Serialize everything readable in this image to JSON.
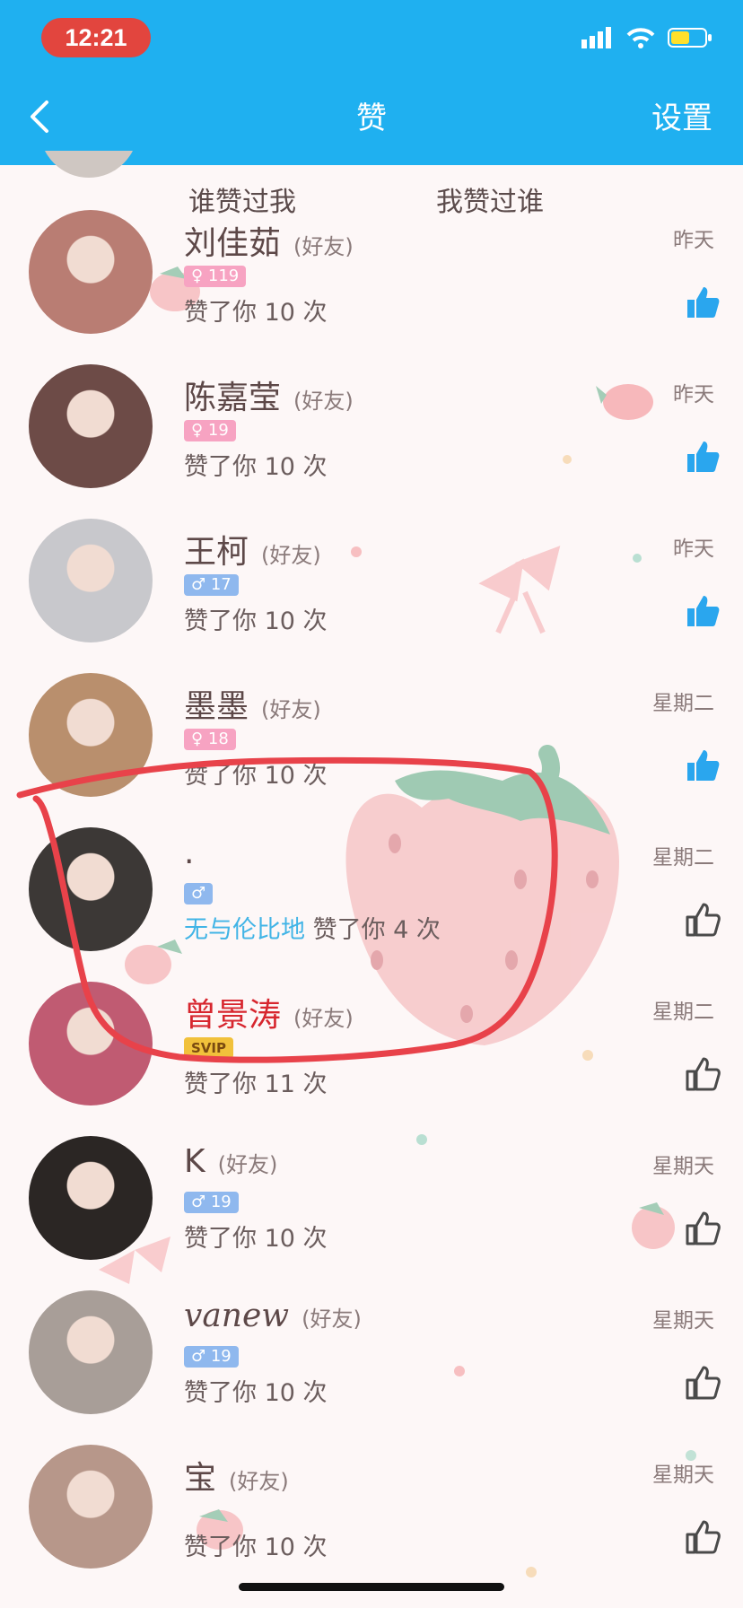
{
  "status_bar": {
    "time": "12:21"
  },
  "header": {
    "back_label": "<",
    "title": "赞",
    "settings_label": "设置"
  },
  "tabs": [
    {
      "label": "谁赞过我"
    },
    {
      "label": "我赞过谁"
    }
  ],
  "rows": [
    {
      "name": "刘佳茹",
      "friend": "(好友)",
      "badge": "♀ 119",
      "badge_type": "f",
      "liked": "赞了你 10 次",
      "date": "昨天",
      "thumb": "blue"
    },
    {
      "name": "陈嘉莹",
      "friend": "(好友)",
      "badge": "♀ 19",
      "badge_type": "f",
      "liked": "赞了你 10 次",
      "date": "昨天",
      "thumb": "blue"
    },
    {
      "name": "王柯",
      "friend": "(好友)",
      "badge": "♂ 17",
      "badge_type": "m",
      "liked": "赞了你 10 次",
      "date": "昨天",
      "thumb": "blue"
    },
    {
      "name": "墨墨",
      "friend": "(好友)",
      "badge": "♀ 18",
      "badge_type": "f",
      "liked": "赞了你 10 次",
      "date": "星期二",
      "thumb": "blue"
    },
    {
      "name": ".",
      "friend": "",
      "badge": "♂",
      "badge_type": "m",
      "via": "无与伦比地",
      "liked": "赞了你 4 次",
      "date": "星期二",
      "thumb": "outline"
    },
    {
      "name": "曾景涛",
      "friend": "(好友)",
      "badge": "SVIP",
      "badge_type": "svip",
      "liked": "赞了你 11 次",
      "date": "星期二",
      "thumb": "outline",
      "vip": true
    },
    {
      "name": "K",
      "friend": "(好友)",
      "badge": "♂ 19",
      "badge_type": "m",
      "liked": "赞了你 10 次",
      "date": "星期天",
      "thumb": "outline"
    },
    {
      "name": "vanew",
      "friend": "(好友)",
      "badge": "♂ 19",
      "badge_type": "m",
      "liked": "赞了你 10 次",
      "date": "星期天",
      "thumb": "outline",
      "script": true
    },
    {
      "name": "宝",
      "friend": "(好友)",
      "badge": "",
      "badge_type": "",
      "liked": "赞了你 10 次",
      "date": "星期天",
      "thumb": "outline"
    }
  ],
  "colors": {
    "nav": "#1fb0f0",
    "accent_blue": "#2aa6ee",
    "annotation_red": "#e8424a",
    "time_pill": "#e2453e"
  },
  "icons": {
    "back": "chevron-left-icon",
    "thumb_filled": "thumbs-up-filled-icon",
    "thumb_outline": "thumbs-up-outline-icon",
    "wifi": "wifi-icon",
    "signal": "signal-icon",
    "battery": "battery-icon"
  }
}
